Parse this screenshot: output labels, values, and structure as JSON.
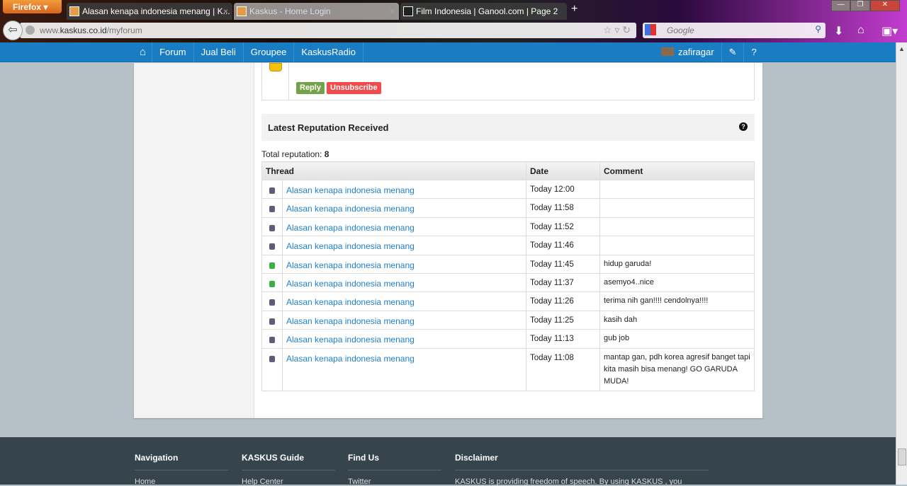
{
  "browser": {
    "menu_label": "Firefox",
    "tabs": [
      {
        "title": "Alasan kenapa indonesia menang | K...",
        "active": false
      },
      {
        "title": "Kaskus - Home Login",
        "active": true
      },
      {
        "title": "Film Indonesia | Ganool.com | Page 2",
        "active": false
      }
    ],
    "url_domain": "www.",
    "url_host": "kaskus.co.id",
    "url_path": "/myforum",
    "search_placeholder": "Google"
  },
  "nav": {
    "items": [
      {
        "label": "Forum"
      },
      {
        "label": "Jual Beli"
      },
      {
        "label": "Groupee"
      },
      {
        "label": "KaskusRadio"
      }
    ],
    "username": "zafiragar"
  },
  "post": {
    "reply_label": "Reply",
    "unsubscribe_label": "Unsubscribe"
  },
  "reputation": {
    "title": "Latest Reputation Received",
    "total_label": "Total reputation:",
    "total_value": "8",
    "columns": [
      "Thread",
      "Date",
      "Comment"
    ],
    "rows": [
      {
        "type": "neutral",
        "thread": "Alasan kenapa indonesia menang",
        "date": "Today 12:00",
        "comment": ""
      },
      {
        "type": "neutral",
        "thread": "Alasan kenapa indonesia menang",
        "date": "Today 11:58",
        "comment": ""
      },
      {
        "type": "neutral",
        "thread": "Alasan kenapa indonesia menang",
        "date": "Today 11:52",
        "comment": ""
      },
      {
        "type": "neutral",
        "thread": "Alasan kenapa indonesia menang",
        "date": "Today 11:46",
        "comment": ""
      },
      {
        "type": "positive",
        "thread": "Alasan kenapa indonesia menang",
        "date": "Today 11:45",
        "comment": "hidup garuda!"
      },
      {
        "type": "positive",
        "thread": "Alasan kenapa indonesia menang",
        "date": "Today 11:37",
        "comment": "asemyo4..nice"
      },
      {
        "type": "neutral",
        "thread": "Alasan kenapa indonesia menang",
        "date": "Today 11:26",
        "comment": "terima nih gan!!!! cendolnya!!!!"
      },
      {
        "type": "neutral",
        "thread": "Alasan kenapa indonesia menang",
        "date": "Today 11:25",
        "comment": "kasih dah"
      },
      {
        "type": "neutral",
        "thread": "Alasan kenapa indonesia menang",
        "date": "Today 11:13",
        "comment": "gub job"
      },
      {
        "type": "neutral",
        "thread": "Alasan kenapa indonesia menang",
        "date": "Today 11:08",
        "comment": "mantap gan, pdh korea agresif banget tapi kita masih bisa menang! GO GARUDA MUDA!"
      }
    ]
  },
  "footer": {
    "columns": [
      {
        "title": "Navigation",
        "first": "Home"
      },
      {
        "title": "KASKUS Guide",
        "first": "Help Center"
      },
      {
        "title": "Find Us",
        "first": "Twitter"
      },
      {
        "title": "Disclaimer",
        "first": "KASKUS is providing freedom of speech. By using KASKUS , you"
      }
    ]
  },
  "colors": {
    "navbar": "#1a7dc4",
    "link": "#1f7fcc",
    "reply": "#74a24b",
    "unsubscribe": "#f24b4b",
    "footer": "#36444b"
  }
}
